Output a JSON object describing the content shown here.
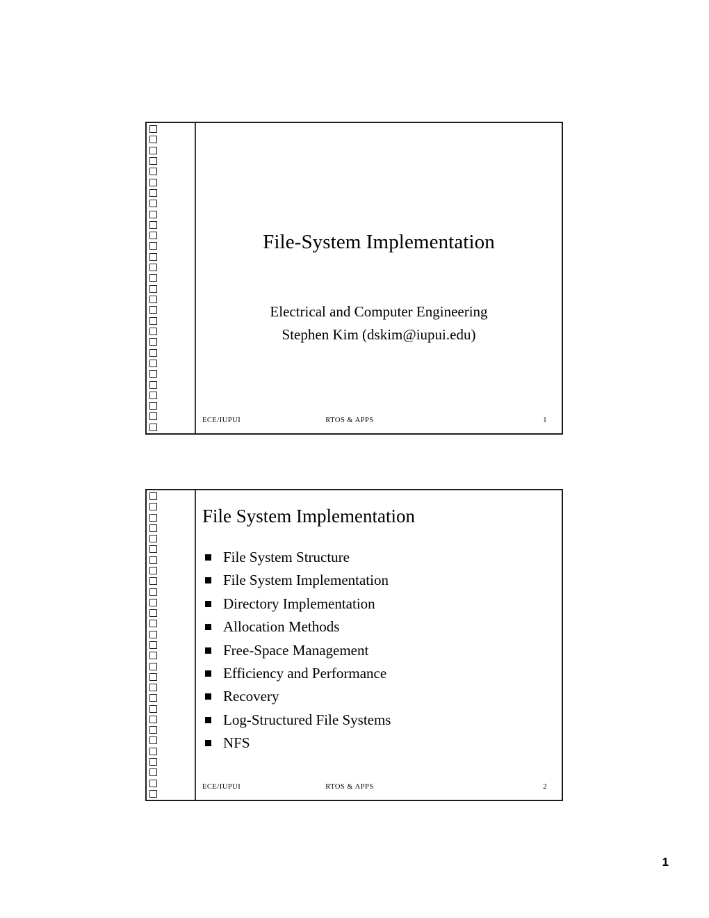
{
  "document": {
    "page_number": "1",
    "slides": [
      {
        "id": "title-slide",
        "title": "File-System Implementation",
        "subtitle_lines": [
          "Electrical and Computer Engineering",
          "Stephen Kim (dskim@iupui.edu)"
        ],
        "footer": {
          "left": "ECE/IUPUI",
          "center": "RTOS & APPS",
          "right": "1"
        },
        "binding_hole_count": 29
      },
      {
        "id": "agenda-slide",
        "title": "File System Implementation",
        "bullets": [
          "File System Structure",
          "File System Implementation",
          "Directory Implementation",
          "Allocation Methods",
          "Free-Space Management",
          "Efficiency and Performance",
          "Recovery",
          "Log-Structured File Systems",
          "NFS"
        ],
        "footer": {
          "left": "ECE/IUPUI",
          "center": "RTOS & APPS",
          "right": "2"
        },
        "binding_hole_count": 29
      }
    ]
  },
  "colors": {
    "page_background": "#ffffff",
    "text": "#000000",
    "frame_border": "#1c1c1c",
    "divider": "#3a3a3a",
    "bullet": "#000000"
  }
}
